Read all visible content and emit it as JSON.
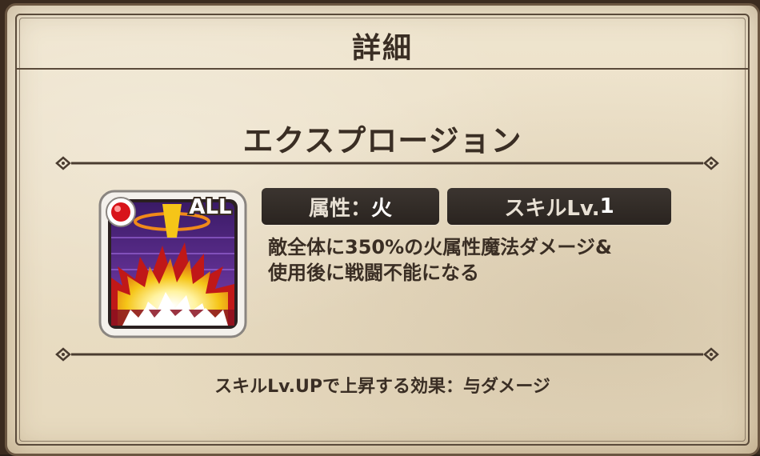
{
  "title": "詳細",
  "skill": {
    "name": "エクスプロージョン",
    "attribute_label": "属性：",
    "attribute_value": "火",
    "level_label": "スキルLv.",
    "level_value": "1",
    "target_badge": "ALL",
    "description_lines": [
      "敵全体に350%の火属性魔法ダメージ&",
      "使用後に戦闘不能になる"
    ]
  },
  "footer": "スキルLv.UPで上昇する効果：与ダメージ",
  "colors": {
    "parchment": "#ebdfc6",
    "ink": "#3a2e24",
    "badge_bg": "#2f2823",
    "icon_purple": "#5b2c8f",
    "icon_fire": "#f5c518",
    "orb_red": "#d8141a"
  },
  "icons": {
    "skill_icon": "explosion-skill-icon",
    "element_orb": "fire-orb-icon"
  }
}
